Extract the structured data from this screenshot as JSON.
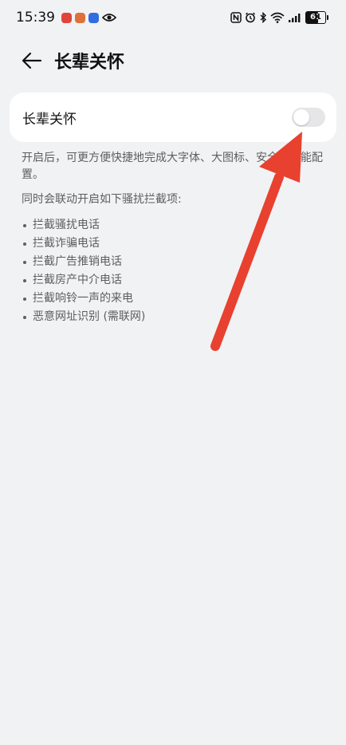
{
  "status_bar": {
    "time": "15:39",
    "battery_level": "61",
    "battery_fraction": 0.61,
    "icons": [
      "app-red-icon",
      "app-orange-icon",
      "app-blue-icon",
      "eye-icon",
      "nfc-icon",
      "alarm-icon",
      "bluetooth-icon",
      "wifi-icon",
      "signal-icon",
      "battery-icon"
    ]
  },
  "header": {
    "back_icon": "arrow-left-icon",
    "title": "长辈关怀"
  },
  "setting": {
    "label": "长辈关怀",
    "toggle_on": false
  },
  "description": {
    "para1": "开启后，可更方便快捷地完成大字体、大图标、安全等功能配置。",
    "para2": "同时会联动开启如下骚扰拦截项:",
    "items": [
      "拦截骚扰电话",
      "拦截诈骗电话",
      "拦截广告推销电话",
      "拦截房产中介电话",
      "拦截响铃一声的来电",
      "恶意网址识别 (需联网)"
    ]
  },
  "colors": {
    "background": "#f1f2f4",
    "card": "#ffffff",
    "toggle_off": "#e6e6e8",
    "annotation_arrow": "#e8412f"
  }
}
